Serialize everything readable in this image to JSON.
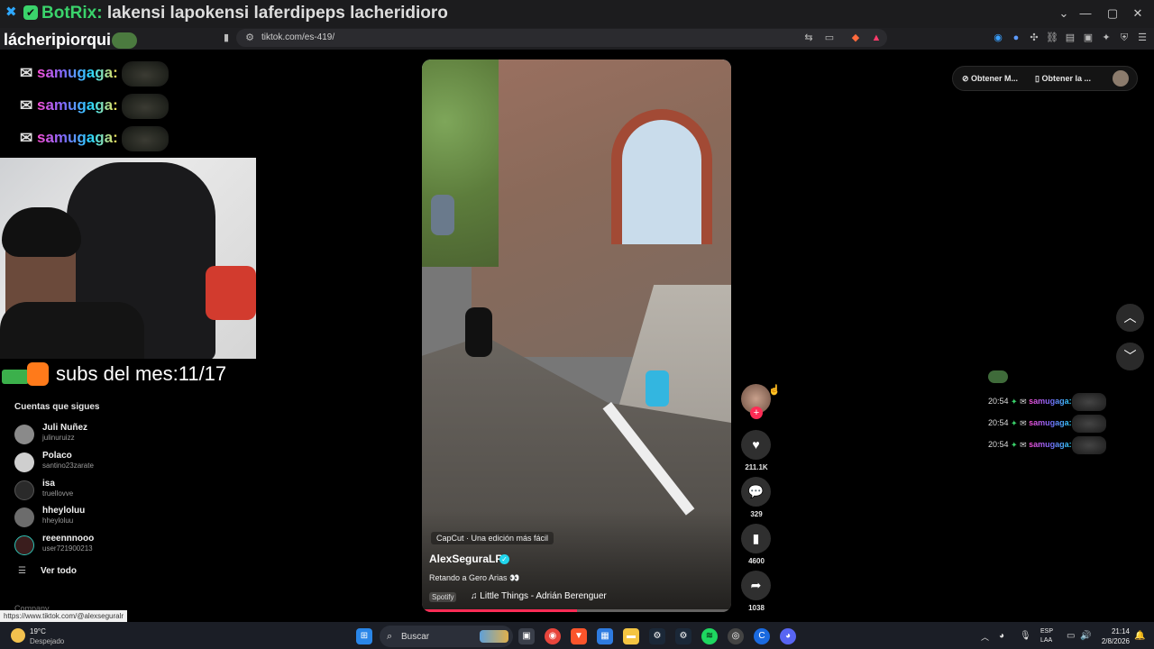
{
  "window": {
    "title_prefix": "BotRix:",
    "title_rest": " lakensi lapokensi laferdipeps lacheridioro",
    "streamer_name": "lácheripiorqui",
    "url": "tiktok.com/es-419/",
    "status_url": "https://www.tiktok.com/@alexseguralr"
  },
  "stream_chat": [
    {
      "name": "samugaga:"
    },
    {
      "name": "samugaga:"
    },
    {
      "name": "samugaga:"
    }
  ],
  "subs_text": "subs del mes:11/17",
  "sidebar": {
    "following_title": "Cuentas que sigues",
    "accounts": [
      {
        "name": "Juli Nuñez",
        "user": "julinuruizz"
      },
      {
        "name": "Polaco",
        "user": "santino23zarate"
      },
      {
        "name": "isa",
        "user": "truellovve"
      },
      {
        "name": "hheyloluu",
        "user": "hheyloluu"
      },
      {
        "name": "reeennnooo",
        "user": "user721900213"
      }
    ],
    "see_all": "Ver todo",
    "company": "Company"
  },
  "video": {
    "capcut": "CapCut · Una edición más fácil",
    "author": "AlexSeguraLR",
    "caption": "Retando a Gero Arias 👀",
    "spotify_tag": "Spotify",
    "music": "Little Things - Adrián Berenguer",
    "progress": 0.5
  },
  "actions": {
    "likes": "211.1K",
    "comments": "329",
    "saves": "4600",
    "shares": "1038"
  },
  "top_right": {
    "get_btn_1": "Obtener M...",
    "get_btn_2": "Obtener la ..."
  },
  "right_chat": [
    {
      "time": "20:54",
      "name": "samugaga:"
    },
    {
      "time": "20:54",
      "name": "samugaga:"
    },
    {
      "time": "20:54",
      "name": "samugaga:"
    }
  ],
  "taskbar": {
    "temp": "19°C",
    "weather": "Despejado",
    "search": "Buscar",
    "lang1": "ESP",
    "lang2": "LAA",
    "time": "21:14",
    "date": "2/8/2026"
  }
}
